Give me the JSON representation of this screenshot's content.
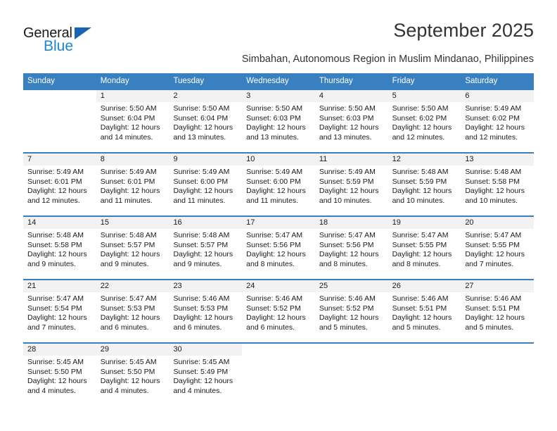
{
  "brand": {
    "name_dark": "General",
    "name_blue": "Blue",
    "triangle_color": "#1565b4",
    "blue_text_color": "#1a86d8"
  },
  "header": {
    "title": "September 2025",
    "subtitle": "Simbahan, Autonomous Region in Muslim Mindanao, Philippines"
  },
  "theme": {
    "header_blue": "#3980c0",
    "daynum_band": "#f2f2f2",
    "text": "#1a1a1a"
  },
  "weekdays": [
    "Sunday",
    "Monday",
    "Tuesday",
    "Wednesday",
    "Thursday",
    "Friday",
    "Saturday"
  ],
  "weeks": [
    [
      {
        "day": "",
        "sunrise": "",
        "sunset": "",
        "daylight1": "",
        "daylight2": "",
        "blank": true
      },
      {
        "day": "1",
        "sunrise": "Sunrise: 5:50 AM",
        "sunset": "Sunset: 6:04 PM",
        "daylight1": "Daylight: 12 hours",
        "daylight2": "and 14 minutes."
      },
      {
        "day": "2",
        "sunrise": "Sunrise: 5:50 AM",
        "sunset": "Sunset: 6:04 PM",
        "daylight1": "Daylight: 12 hours",
        "daylight2": "and 13 minutes."
      },
      {
        "day": "3",
        "sunrise": "Sunrise: 5:50 AM",
        "sunset": "Sunset: 6:03 PM",
        "daylight1": "Daylight: 12 hours",
        "daylight2": "and 13 minutes."
      },
      {
        "day": "4",
        "sunrise": "Sunrise: 5:50 AM",
        "sunset": "Sunset: 6:03 PM",
        "daylight1": "Daylight: 12 hours",
        "daylight2": "and 13 minutes."
      },
      {
        "day": "5",
        "sunrise": "Sunrise: 5:50 AM",
        "sunset": "Sunset: 6:02 PM",
        "daylight1": "Daylight: 12 hours",
        "daylight2": "and 12 minutes."
      },
      {
        "day": "6",
        "sunrise": "Sunrise: 5:49 AM",
        "sunset": "Sunset: 6:02 PM",
        "daylight1": "Daylight: 12 hours",
        "daylight2": "and 12 minutes."
      }
    ],
    [
      {
        "day": "7",
        "sunrise": "Sunrise: 5:49 AM",
        "sunset": "Sunset: 6:01 PM",
        "daylight1": "Daylight: 12 hours",
        "daylight2": "and 12 minutes."
      },
      {
        "day": "8",
        "sunrise": "Sunrise: 5:49 AM",
        "sunset": "Sunset: 6:01 PM",
        "daylight1": "Daylight: 12 hours",
        "daylight2": "and 11 minutes."
      },
      {
        "day": "9",
        "sunrise": "Sunrise: 5:49 AM",
        "sunset": "Sunset: 6:00 PM",
        "daylight1": "Daylight: 12 hours",
        "daylight2": "and 11 minutes."
      },
      {
        "day": "10",
        "sunrise": "Sunrise: 5:49 AM",
        "sunset": "Sunset: 6:00 PM",
        "daylight1": "Daylight: 12 hours",
        "daylight2": "and 11 minutes."
      },
      {
        "day": "11",
        "sunrise": "Sunrise: 5:49 AM",
        "sunset": "Sunset: 5:59 PM",
        "daylight1": "Daylight: 12 hours",
        "daylight2": "and 10 minutes."
      },
      {
        "day": "12",
        "sunrise": "Sunrise: 5:48 AM",
        "sunset": "Sunset: 5:59 PM",
        "daylight1": "Daylight: 12 hours",
        "daylight2": "and 10 minutes."
      },
      {
        "day": "13",
        "sunrise": "Sunrise: 5:48 AM",
        "sunset": "Sunset: 5:58 PM",
        "daylight1": "Daylight: 12 hours",
        "daylight2": "and 10 minutes."
      }
    ],
    [
      {
        "day": "14",
        "sunrise": "Sunrise: 5:48 AM",
        "sunset": "Sunset: 5:58 PM",
        "daylight1": "Daylight: 12 hours",
        "daylight2": "and 9 minutes."
      },
      {
        "day": "15",
        "sunrise": "Sunrise: 5:48 AM",
        "sunset": "Sunset: 5:57 PM",
        "daylight1": "Daylight: 12 hours",
        "daylight2": "and 9 minutes."
      },
      {
        "day": "16",
        "sunrise": "Sunrise: 5:48 AM",
        "sunset": "Sunset: 5:57 PM",
        "daylight1": "Daylight: 12 hours",
        "daylight2": "and 9 minutes."
      },
      {
        "day": "17",
        "sunrise": "Sunrise: 5:47 AM",
        "sunset": "Sunset: 5:56 PM",
        "daylight1": "Daylight: 12 hours",
        "daylight2": "and 8 minutes."
      },
      {
        "day": "18",
        "sunrise": "Sunrise: 5:47 AM",
        "sunset": "Sunset: 5:56 PM",
        "daylight1": "Daylight: 12 hours",
        "daylight2": "and 8 minutes."
      },
      {
        "day": "19",
        "sunrise": "Sunrise: 5:47 AM",
        "sunset": "Sunset: 5:55 PM",
        "daylight1": "Daylight: 12 hours",
        "daylight2": "and 8 minutes."
      },
      {
        "day": "20",
        "sunrise": "Sunrise: 5:47 AM",
        "sunset": "Sunset: 5:55 PM",
        "daylight1": "Daylight: 12 hours",
        "daylight2": "and 7 minutes."
      }
    ],
    [
      {
        "day": "21",
        "sunrise": "Sunrise: 5:47 AM",
        "sunset": "Sunset: 5:54 PM",
        "daylight1": "Daylight: 12 hours",
        "daylight2": "and 7 minutes."
      },
      {
        "day": "22",
        "sunrise": "Sunrise: 5:47 AM",
        "sunset": "Sunset: 5:53 PM",
        "daylight1": "Daylight: 12 hours",
        "daylight2": "and 6 minutes."
      },
      {
        "day": "23",
        "sunrise": "Sunrise: 5:46 AM",
        "sunset": "Sunset: 5:53 PM",
        "daylight1": "Daylight: 12 hours",
        "daylight2": "and 6 minutes."
      },
      {
        "day": "24",
        "sunrise": "Sunrise: 5:46 AM",
        "sunset": "Sunset: 5:52 PM",
        "daylight1": "Daylight: 12 hours",
        "daylight2": "and 6 minutes."
      },
      {
        "day": "25",
        "sunrise": "Sunrise: 5:46 AM",
        "sunset": "Sunset: 5:52 PM",
        "daylight1": "Daylight: 12 hours",
        "daylight2": "and 5 minutes."
      },
      {
        "day": "26",
        "sunrise": "Sunrise: 5:46 AM",
        "sunset": "Sunset: 5:51 PM",
        "daylight1": "Daylight: 12 hours",
        "daylight2": "and 5 minutes."
      },
      {
        "day": "27",
        "sunrise": "Sunrise: 5:46 AM",
        "sunset": "Sunset: 5:51 PM",
        "daylight1": "Daylight: 12 hours",
        "daylight2": "and 5 minutes."
      }
    ],
    [
      {
        "day": "28",
        "sunrise": "Sunrise: 5:45 AM",
        "sunset": "Sunset: 5:50 PM",
        "daylight1": "Daylight: 12 hours",
        "daylight2": "and 4 minutes."
      },
      {
        "day": "29",
        "sunrise": "Sunrise: 5:45 AM",
        "sunset": "Sunset: 5:50 PM",
        "daylight1": "Daylight: 12 hours",
        "daylight2": "and 4 minutes."
      },
      {
        "day": "30",
        "sunrise": "Sunrise: 5:45 AM",
        "sunset": "Sunset: 5:49 PM",
        "daylight1": "Daylight: 12 hours",
        "daylight2": "and 4 minutes."
      },
      {
        "day": "",
        "sunrise": "",
        "sunset": "",
        "daylight1": "",
        "daylight2": "",
        "blank": true
      },
      {
        "day": "",
        "sunrise": "",
        "sunset": "",
        "daylight1": "",
        "daylight2": "",
        "blank": true
      },
      {
        "day": "",
        "sunrise": "",
        "sunset": "",
        "daylight1": "",
        "daylight2": "",
        "blank": true
      },
      {
        "day": "",
        "sunrise": "",
        "sunset": "",
        "daylight1": "",
        "daylight2": "",
        "blank": true
      }
    ]
  ]
}
